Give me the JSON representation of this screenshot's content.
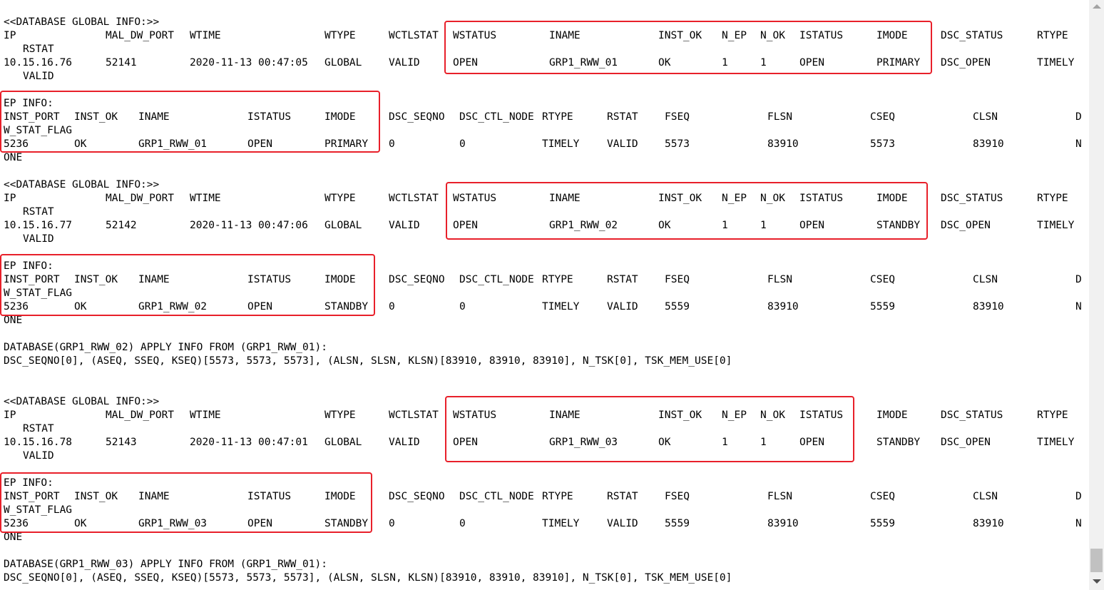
{
  "blocks": [
    {
      "global_header": "<<DATABASE GLOBAL INFO:>>",
      "global_cols": {
        "ip": "IP",
        "mal_dw_port": "MAL_DW_PORT",
        "wtime": "WTIME",
        "wtype": "WTYPE",
        "wctlstat": "WCTLSTAT",
        "wstatus": "WSTATUS",
        "iname": "INAME",
        "inst_ok": "INST_OK",
        "n_ep": "N_EP",
        "n_ok": "N_OK",
        "istatus": "ISTATUS",
        "imode": "IMODE",
        "dsc_status": "DSC_STATUS",
        "rtype": "RTYPE",
        "rstat": "RSTAT"
      },
      "global_vals": {
        "ip": "10.15.16.76",
        "mal_dw_port": "52141",
        "wtime": "2020-11-13 00:47:05",
        "wtype": "GLOBAL",
        "wctlstat": "VALID",
        "wstatus": "OPEN",
        "iname": "GRP1_RWW_01",
        "inst_ok": "OK",
        "n_ep": "1",
        "n_ok": "1",
        "istatus": "OPEN",
        "imode": "PRIMARY",
        "dsc_status": "DSC_OPEN",
        "rtype": "TIMELY",
        "rstat": "VALID"
      },
      "ep_header": "EP INFO:",
      "ep_cols": {
        "inst_port": "INST_PORT",
        "inst_ok": "INST_OK",
        "iname": "INAME",
        "istatus": "ISTATUS",
        "imode": "IMODE",
        "dsc_seqno": "DSC_SEQNO",
        "dsc_ctl_node": "DSC_CTL_NODE",
        "rtype": "RTYPE",
        "rstat": "RSTAT",
        "fseq": "FSEQ",
        "flsn": "FLSN",
        "cseq": "CSEQ",
        "clsn": "CLSN",
        "d": "D",
        "w_stat_flag": "W_STAT_FLAG"
      },
      "ep_vals": {
        "inst_port": "5236",
        "inst_ok": "OK",
        "iname": "GRP1_RWW_01",
        "istatus": "OPEN",
        "imode": "PRIMARY",
        "dsc_seqno": "0",
        "dsc_ctl_node": "0",
        "rtype": "TIMELY",
        "rstat": "VALID",
        "fseq": "5573",
        "flsn": "83910",
        "cseq": "5573",
        "clsn": "83910",
        "n": "N",
        "one": "ONE"
      }
    },
    {
      "global_header": "<<DATABASE GLOBAL INFO:>>",
      "global_cols": {
        "ip": "IP",
        "mal_dw_port": "MAL_DW_PORT",
        "wtime": "WTIME",
        "wtype": "WTYPE",
        "wctlstat": "WCTLSTAT",
        "wstatus": "WSTATUS",
        "iname": "INAME",
        "inst_ok": "INST_OK",
        "n_ep": "N_EP",
        "n_ok": "N_OK",
        "istatus": "ISTATUS",
        "imode": "IMODE",
        "dsc_status": "DSC_STATUS",
        "rtype": "RTYPE",
        "rstat": "RSTAT"
      },
      "global_vals": {
        "ip": "10.15.16.77",
        "mal_dw_port": "52142",
        "wtime": "2020-11-13 00:47:06",
        "wtype": "GLOBAL",
        "wctlstat": "VALID",
        "wstatus": "OPEN",
        "iname": "GRP1_RWW_02",
        "inst_ok": "OK",
        "n_ep": "1",
        "n_ok": "1",
        "istatus": "OPEN",
        "imode": "STANDBY",
        "dsc_status": "DSC_OPEN",
        "rtype": "TIMELY",
        "rstat": "VALID"
      },
      "ep_header": "EP INFO:",
      "ep_cols": {
        "inst_port": "INST_PORT",
        "inst_ok": "INST_OK",
        "iname": "INAME",
        "istatus": "ISTATUS",
        "imode": "IMODE",
        "dsc_seqno": "DSC_SEQNO",
        "dsc_ctl_node": "DSC_CTL_NODE",
        "rtype": "RTYPE",
        "rstat": "RSTAT",
        "fseq": "FSEQ",
        "flsn": "FLSN",
        "cseq": "CSEQ",
        "clsn": "CLSN",
        "d": "D",
        "w_stat_flag": "W_STAT_FLAG"
      },
      "ep_vals": {
        "inst_port": "5236",
        "inst_ok": "OK",
        "iname": "GRP1_RWW_02",
        "istatus": "OPEN",
        "imode": "STANDBY",
        "dsc_seqno": "0",
        "dsc_ctl_node": "0",
        "rtype": "TIMELY",
        "rstat": "VALID",
        "fseq": "5559",
        "flsn": "83910",
        "cseq": "5559",
        "clsn": "83910",
        "n": "N",
        "one": "ONE"
      },
      "apply_line1": "DATABASE(GRP1_RWW_02) APPLY INFO FROM (GRP1_RWW_01):",
      "apply_line2": "DSC_SEQNO[0], (ASEQ, SSEQ, KSEQ)[5573, 5573, 5573], (ALSN, SLSN, KLSN)[83910, 83910, 83910], N_TSK[0], TSK_MEM_USE[0]"
    },
    {
      "global_header": "<<DATABASE GLOBAL INFO:>>",
      "global_cols": {
        "ip": "IP",
        "mal_dw_port": "MAL_DW_PORT",
        "wtime": "WTIME",
        "wtype": "WTYPE",
        "wctlstat": "WCTLSTAT",
        "wstatus": "WSTATUS",
        "iname": "INAME",
        "inst_ok": "INST_OK",
        "n_ep": "N_EP",
        "n_ok": "N_OK",
        "istatus": "ISTATUS",
        "imode": "IMODE",
        "dsc_status": "DSC_STATUS",
        "rtype": "RTYPE",
        "rstat": "RSTAT"
      },
      "global_vals": {
        "ip": "10.15.16.78",
        "mal_dw_port": "52143",
        "wtime": "2020-11-13 00:47:01",
        "wtype": "GLOBAL",
        "wctlstat": "VALID",
        "wstatus": "OPEN",
        "iname": "GRP1_RWW_03",
        "inst_ok": "OK",
        "n_ep": "1",
        "n_ok": "1",
        "istatus": "OPEN",
        "imode": "STANDBY",
        "dsc_status": "DSC_OPEN",
        "rtype": "TIMELY",
        "rstat": "VALID"
      },
      "ep_header": "EP INFO:",
      "ep_cols": {
        "inst_port": "INST_PORT",
        "inst_ok": "INST_OK",
        "iname": "INAME",
        "istatus": "ISTATUS",
        "imode": "IMODE",
        "dsc_seqno": "DSC_SEQNO",
        "dsc_ctl_node": "DSC_CTL_NODE",
        "rtype": "RTYPE",
        "rstat": "RSTAT",
        "fseq": "FSEQ",
        "flsn": "FLSN",
        "cseq": "CSEQ",
        "clsn": "CLSN",
        "d": "D",
        "w_stat_flag": "W_STAT_FLAG"
      },
      "ep_vals": {
        "inst_port": "5236",
        "inst_ok": "OK",
        "iname": "GRP1_RWW_03",
        "istatus": "OPEN",
        "imode": "STANDBY",
        "dsc_seqno": "0",
        "dsc_ctl_node": "0",
        "rtype": "TIMELY",
        "rstat": "VALID",
        "fseq": "5559",
        "flsn": "83910",
        "cseq": "5559",
        "clsn": "83910",
        "n": "N",
        "one": "ONE"
      },
      "apply_line1": "DATABASE(GRP1_RWW_03) APPLY INFO FROM (GRP1_RWW_01):",
      "apply_line2": "DSC_SEQNO[0], (ASEQ, SSEQ, KSEQ)[5573, 5573, 5573], (ALSN, SLSN, KLSN)[83910, 83910, 83910], N_TSK[0], TSK_MEM_USE[0]"
    }
  ],
  "highlight_color": "#e8202a"
}
